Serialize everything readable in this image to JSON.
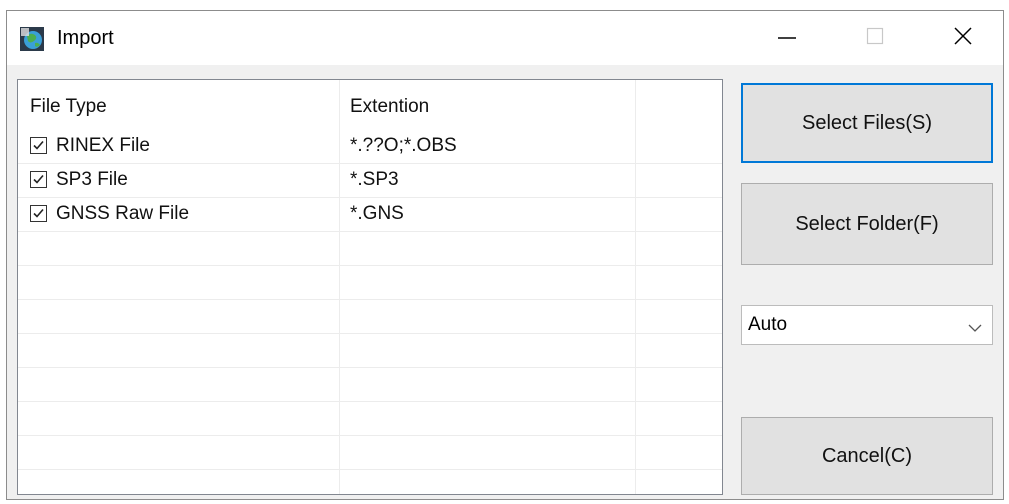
{
  "window": {
    "title": "Import",
    "controls": {
      "minimize": "minimize",
      "maximize": "maximize",
      "close": "close"
    }
  },
  "list": {
    "columns": [
      "File Type",
      "Extention"
    ],
    "rows": [
      {
        "type": "RINEX File",
        "extension": "*.??O;*.OBS",
        "checked": true
      },
      {
        "type": "SP3 File",
        "extension": "*.SP3",
        "checked": true
      },
      {
        "type": "GNSS Raw File",
        "extension": "*.GNS",
        "checked": true
      }
    ]
  },
  "buttons": {
    "select_files": "Select Files(S)",
    "select_folder": "Select Folder(F)",
    "cancel": "Cancel(C)"
  },
  "mode_select": {
    "value": "Auto"
  },
  "colors": {
    "accent": "#0078d7",
    "button_face": "#e1e1e1",
    "window_bg": "#f0f0f0"
  }
}
